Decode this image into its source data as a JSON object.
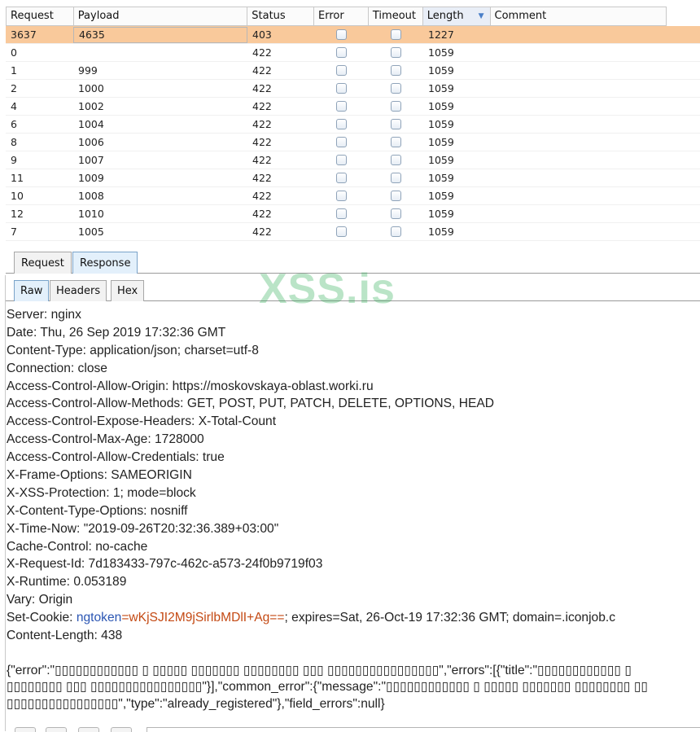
{
  "results_table": {
    "columns": [
      "Request",
      "Payload",
      "Status",
      "Error",
      "Timeout",
      "Length",
      "Comment"
    ],
    "sorted_column": "Length",
    "rows": [
      {
        "request": "3637",
        "payload": "4635",
        "status": "403",
        "error": false,
        "timeout": false,
        "length": "1227",
        "comment": "",
        "selected": true
      },
      {
        "request": "0",
        "payload": "",
        "status": "422",
        "error": false,
        "timeout": false,
        "length": "1059",
        "comment": ""
      },
      {
        "request": "1",
        "payload": "999",
        "status": "422",
        "error": false,
        "timeout": false,
        "length": "1059",
        "comment": ""
      },
      {
        "request": "2",
        "payload": "1000",
        "status": "422",
        "error": false,
        "timeout": false,
        "length": "1059",
        "comment": ""
      },
      {
        "request": "4",
        "payload": "1002",
        "status": "422",
        "error": false,
        "timeout": false,
        "length": "1059",
        "comment": ""
      },
      {
        "request": "6",
        "payload": "1004",
        "status": "422",
        "error": false,
        "timeout": false,
        "length": "1059",
        "comment": ""
      },
      {
        "request": "8",
        "payload": "1006",
        "status": "422",
        "error": false,
        "timeout": false,
        "length": "1059",
        "comment": ""
      },
      {
        "request": "9",
        "payload": "1007",
        "status": "422",
        "error": false,
        "timeout": false,
        "length": "1059",
        "comment": ""
      },
      {
        "request": "11",
        "payload": "1009",
        "status": "422",
        "error": false,
        "timeout": false,
        "length": "1059",
        "comment": ""
      },
      {
        "request": "10",
        "payload": "1008",
        "status": "422",
        "error": false,
        "timeout": false,
        "length": "1059",
        "comment": ""
      },
      {
        "request": "12",
        "payload": "1010",
        "status": "422",
        "error": false,
        "timeout": false,
        "length": "1059",
        "comment": ""
      },
      {
        "request": "7",
        "payload": "1005",
        "status": "422",
        "error": false,
        "timeout": false,
        "length": "1059",
        "comment": ""
      }
    ]
  },
  "main_tabs": [
    {
      "label": "Request",
      "active": false
    },
    {
      "label": "Response",
      "active": true
    }
  ],
  "sub_tabs": [
    {
      "label": "Raw",
      "active": true
    },
    {
      "label": "Headers",
      "active": false
    },
    {
      "label": "Hex",
      "active": false
    }
  ],
  "watermark": "XSS.is",
  "response": {
    "headers": [
      "Server: nginx",
      "Date: Thu, 26 Sep 2019 17:32:36 GMT",
      "Content-Type: application/json; charset=utf-8",
      "Connection: close",
      "Access-Control-Allow-Origin: https://moskovskaya-oblast.worki.ru",
      "Access-Control-Allow-Methods: GET, POST, PUT, PATCH, DELETE, OPTIONS, HEAD",
      "Access-Control-Expose-Headers: X-Total-Count",
      "Access-Control-Max-Age: 1728000",
      "Access-Control-Allow-Credentials: true",
      "X-Frame-Options: SAMEORIGIN",
      "X-XSS-Protection: 1; mode=block",
      "X-Content-Type-Options: nosniff",
      "X-Time-Now: \"2019-09-26T20:32:36.389+03:00\"",
      "Cache-Control: no-cache",
      "X-Request-Id: 7d183433-797c-462c-a573-24f0b9719f03",
      "X-Runtime: 0.053189",
      "Vary: Origin"
    ],
    "set_cookie": {
      "prefix": "Set-Cookie: ",
      "name": "ngtoken",
      "eq": "=",
      "value": "wKjSJI2M9jSirlbMDlI+Ag==",
      "suffix": "; expires=Sat, 26-Oct-19 17:32:36 GMT; domain=.iconjob.c"
    },
    "content_length": "Content-Length: 438",
    "body_lines": [
      "{\"error\":\"▯▯▯▯▯▯▯▯▯▯▯▯ ▯ ▯▯▯▯▯ ▯▯▯▯▯▯▯ ▯▯▯▯▯▯▯▯ ▯▯▯ ▯▯▯▯▯▯▯▯▯▯▯▯▯▯▯▯\",\"errors\":[{\"title\":\"▯▯▯▯▯▯▯▯▯▯▯▯ ▯",
      "▯▯▯▯▯▯▯▯ ▯▯▯ ▯▯▯▯▯▯▯▯▯▯▯▯▯▯▯▯\"}],\"common_error\":{\"message\":\"▯▯▯▯▯▯▯▯▯▯▯▯ ▯ ▯▯▯▯▯ ▯▯▯▯▯▯▯ ▯▯▯▯▯▯▯▯ ▯▯",
      "▯▯▯▯▯▯▯▯▯▯▯▯▯▯▯▯\",\"type\":\"already_registered\"},\"field_errors\":null}"
    ]
  }
}
